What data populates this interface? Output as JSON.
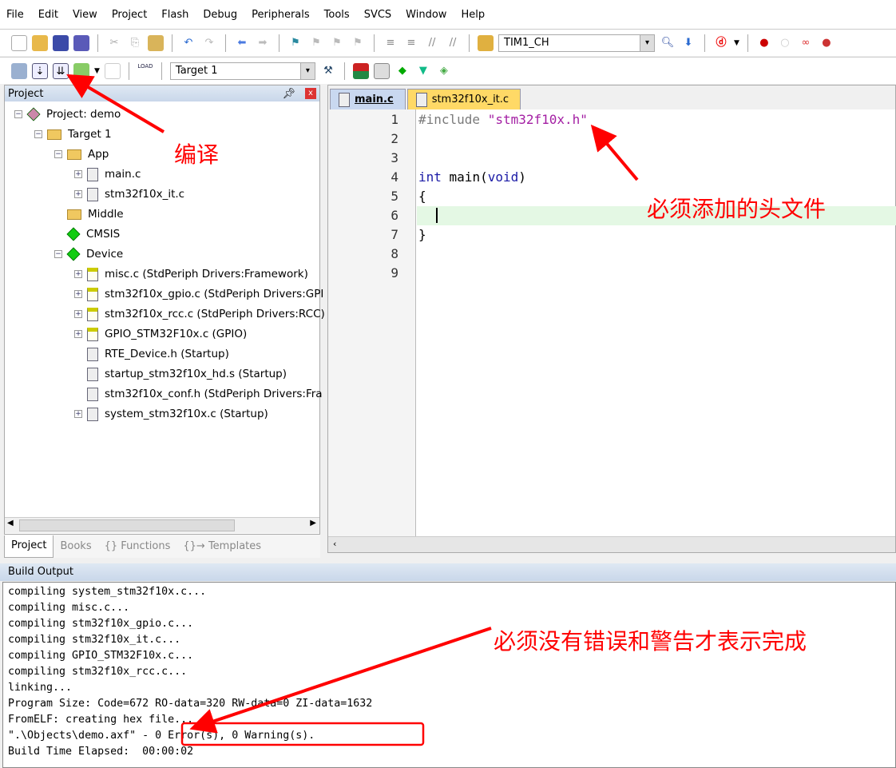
{
  "menu": [
    "File",
    "Edit",
    "View",
    "Project",
    "Flash",
    "Debug",
    "Peripherals",
    "Tools",
    "SVCS",
    "Window",
    "Help"
  ],
  "toolbar1": {
    "find_combo": "TIM1_CH"
  },
  "toolbar2": {
    "target_combo": "Target 1",
    "load_label": "LOAD"
  },
  "project_panel": {
    "title": "Project",
    "tree": [
      {
        "label": "Project: demo",
        "level": 0,
        "icon": "project-icon",
        "expander": "-"
      },
      {
        "label": "Target 1",
        "level": 1,
        "icon": "folder-open-icon",
        "expander": "-"
      },
      {
        "label": "App",
        "level": 2,
        "icon": "folder-open-icon",
        "expander": "-"
      },
      {
        "label": "main.c",
        "level": 3,
        "icon": "file-icon",
        "expander": "+"
      },
      {
        "label": "stm32f10x_it.c",
        "level": 3,
        "icon": "file-icon",
        "expander": "+"
      },
      {
        "label": "Middle",
        "level": 2,
        "icon": "folder-icon",
        "expander": ""
      },
      {
        "label": "CMSIS",
        "level": 2,
        "icon": "component-icon",
        "expander": ""
      },
      {
        "label": "Device",
        "level": 2,
        "icon": "component-icon",
        "expander": "-"
      },
      {
        "label": "misc.c (StdPeriph Drivers:Framework)",
        "level": 3,
        "icon": "key-file-icon",
        "expander": "+"
      },
      {
        "label": "stm32f10x_gpio.c (StdPeriph Drivers:GPI",
        "level": 3,
        "icon": "key-file-icon",
        "expander": "+"
      },
      {
        "label": "stm32f10x_rcc.c (StdPeriph Drivers:RCC)",
        "level": 3,
        "icon": "key-file-icon",
        "expander": "+"
      },
      {
        "label": "GPIO_STM32F10x.c (GPIO)",
        "level": 3,
        "icon": "key-file-icon",
        "expander": "+"
      },
      {
        "label": "RTE_Device.h (Startup)",
        "level": 3,
        "icon": "file-icon",
        "expander": ""
      },
      {
        "label": "startup_stm32f10x_hd.s (Startup)",
        "level": 3,
        "icon": "file-icon",
        "expander": ""
      },
      {
        "label": "stm32f10x_conf.h (StdPeriph Drivers:Fra",
        "level": 3,
        "icon": "file-icon",
        "expander": ""
      },
      {
        "label": "system_stm32f10x.c (Startup)",
        "level": 3,
        "icon": "file-icon",
        "expander": "+"
      }
    ],
    "bottom_tabs": [
      "Project",
      "Books",
      "{} Functions",
      "{}→ Templates"
    ]
  },
  "editor": {
    "tabs": [
      {
        "label": "main.c",
        "active": true
      },
      {
        "label": "stm32f10x_it.c",
        "active": false
      }
    ],
    "lines": [
      {
        "n": "1",
        "code": "#include \"stm32f10x.h\""
      },
      {
        "n": "2",
        "code": ""
      },
      {
        "n": "3",
        "code": ""
      },
      {
        "n": "4",
        "code": "int main(void)"
      },
      {
        "n": "5",
        "code": "{"
      },
      {
        "n": "6",
        "code": ""
      },
      {
        "n": "7",
        "code": "}"
      },
      {
        "n": "8",
        "code": ""
      },
      {
        "n": "9",
        "code": ""
      }
    ]
  },
  "build_output": {
    "title": "Build Output",
    "lines": [
      "compiling system_stm32f10x.c...",
      "compiling misc.c...",
      "compiling stm32f10x_gpio.c...",
      "compiling stm32f10x_it.c...",
      "compiling GPIO_STM32F10x.c...",
      "compiling stm32f10x_rcc.c...",
      "linking...",
      "Program Size: Code=672 RO-data=320 RW-data=0 ZI-data=1632",
      "FromELF: creating hex file...",
      "\".\\Objects\\demo.axf\" - 0 Error(s), 0 Warning(s).",
      "Build Time Elapsed:  00:00:02"
    ]
  },
  "annotations": {
    "compile": "编译",
    "header": "必须添加的头文件",
    "no_errors": "必须没有错误和警告才表示完成",
    "color": "#ff0000"
  }
}
